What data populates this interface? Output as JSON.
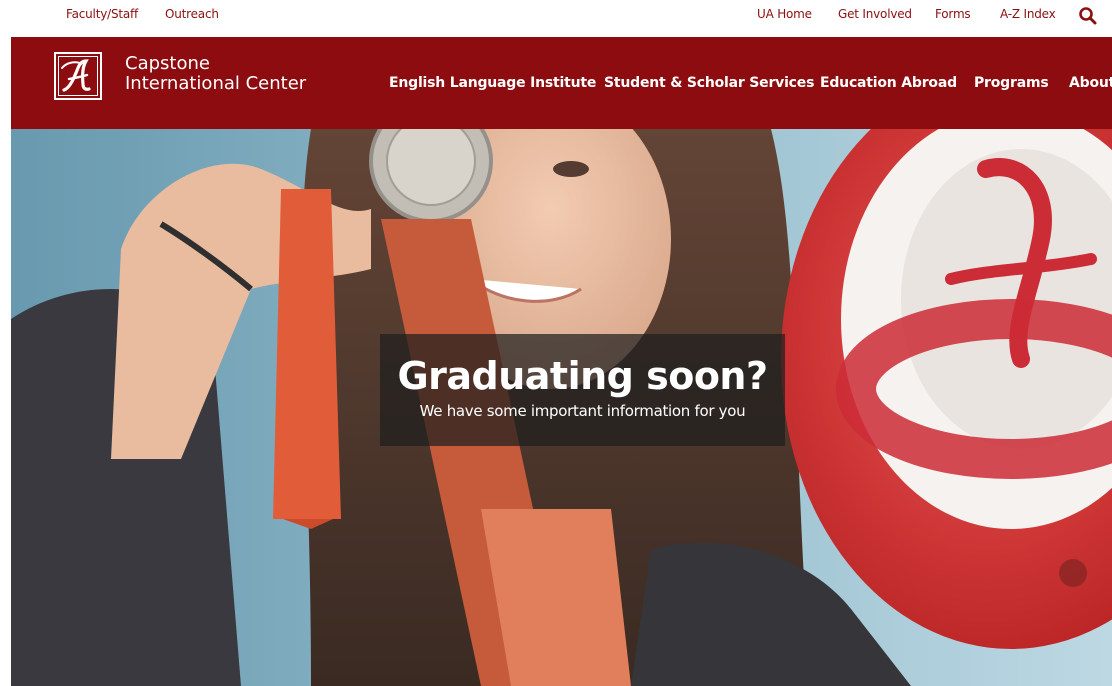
{
  "utility_nav": {
    "left_links": [
      "Faculty/Staff",
      "Outreach"
    ],
    "right_links": [
      "UA Home",
      "Get Involved",
      "Forms",
      "A-Z Index"
    ],
    "search_icon": "search-icon"
  },
  "header": {
    "logo_icon": "script-a-logo",
    "site_name_line1": "Capstone",
    "site_name_line2": "International Center",
    "nav_items": [
      "English Language Institute",
      "Student & Scholar Services",
      "Education Abroad",
      "Programs",
      "About"
    ]
  },
  "hero": {
    "headline": "Graduating soon?",
    "subline": "We have some important information for you"
  },
  "colors": {
    "brand_crimson": "#8c0c0f",
    "link_color": "#8b1010",
    "overlay": "rgba(30,30,30,0.72)"
  }
}
